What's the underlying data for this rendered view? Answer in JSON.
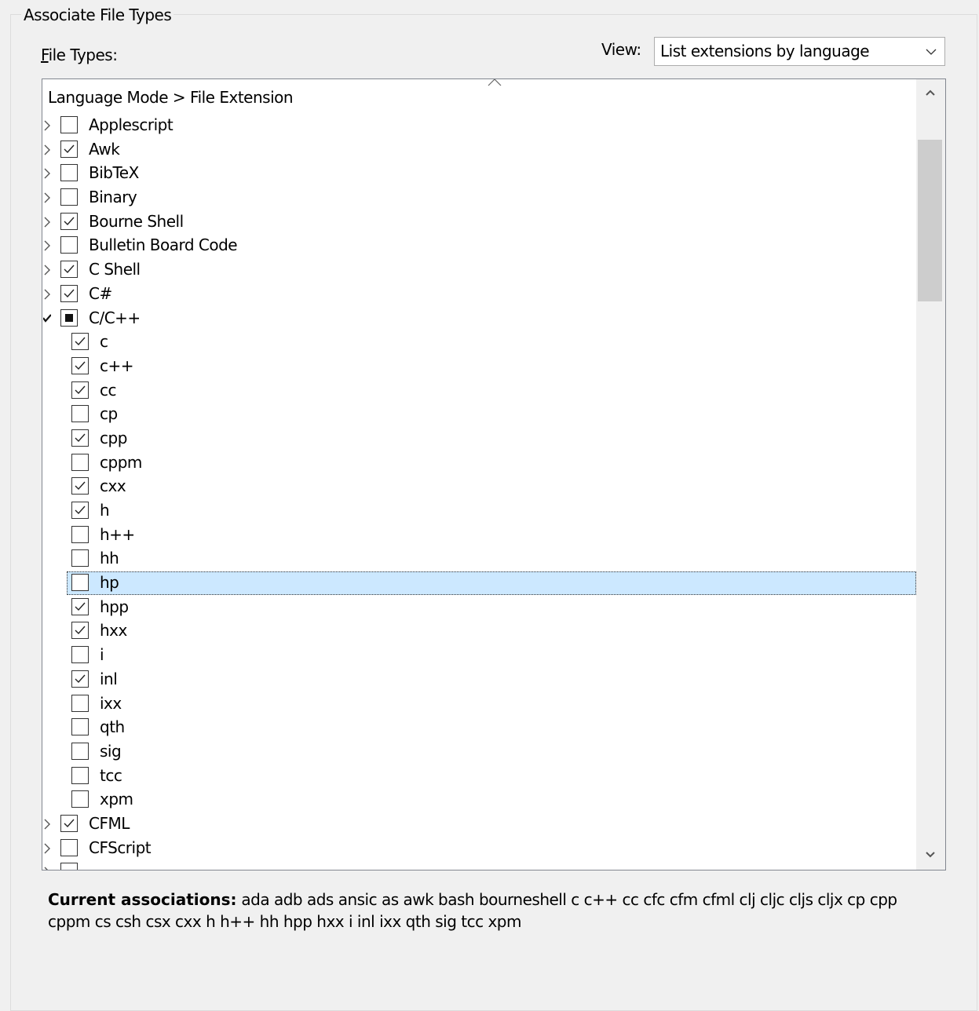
{
  "group": {
    "title": "Associate File Types"
  },
  "file_types": {
    "label_mnemonic": "F",
    "label_rest": "ile Types:"
  },
  "view": {
    "label": "View:",
    "selected": "List extensions by language"
  },
  "list": {
    "header": "Language Mode > File Extension",
    "rows": [
      {
        "level": 0,
        "expander": "collapsed",
        "state": "unchecked",
        "label": "Applescript"
      },
      {
        "level": 0,
        "expander": "collapsed",
        "state": "checked",
        "label": "Awk"
      },
      {
        "level": 0,
        "expander": "collapsed",
        "state": "unchecked",
        "label": "BibTeX"
      },
      {
        "level": 0,
        "expander": "collapsed",
        "state": "unchecked",
        "label": "Binary"
      },
      {
        "level": 0,
        "expander": "collapsed",
        "state": "checked",
        "label": "Bourne Shell"
      },
      {
        "level": 0,
        "expander": "collapsed",
        "state": "unchecked",
        "label": "Bulletin Board Code"
      },
      {
        "level": 0,
        "expander": "collapsed",
        "state": "checked",
        "label": "C Shell"
      },
      {
        "level": 0,
        "expander": "collapsed",
        "state": "checked",
        "label": "C#"
      },
      {
        "level": 0,
        "expander": "expanded",
        "state": "indeterminate",
        "label": "C/C++"
      },
      {
        "level": 1,
        "state": "checked",
        "label": "c"
      },
      {
        "level": 1,
        "state": "checked",
        "label": "c++"
      },
      {
        "level": 1,
        "state": "checked",
        "label": "cc"
      },
      {
        "level": 1,
        "state": "unchecked",
        "label": "cp"
      },
      {
        "level": 1,
        "state": "checked",
        "label": "cpp"
      },
      {
        "level": 1,
        "state": "unchecked",
        "label": "cppm"
      },
      {
        "level": 1,
        "state": "checked",
        "label": "cxx"
      },
      {
        "level": 1,
        "state": "checked",
        "label": "h"
      },
      {
        "level": 1,
        "state": "unchecked",
        "label": "h++"
      },
      {
        "level": 1,
        "state": "unchecked",
        "label": "hh"
      },
      {
        "level": 1,
        "state": "unchecked",
        "label": "hp",
        "selected": true
      },
      {
        "level": 1,
        "state": "checked",
        "label": "hpp"
      },
      {
        "level": 1,
        "state": "checked",
        "label": "hxx"
      },
      {
        "level": 1,
        "state": "unchecked",
        "label": "i"
      },
      {
        "level": 1,
        "state": "checked",
        "label": "inl"
      },
      {
        "level": 1,
        "state": "unchecked",
        "label": "ixx"
      },
      {
        "level": 1,
        "state": "unchecked",
        "label": "qth"
      },
      {
        "level": 1,
        "state": "unchecked",
        "label": "sig"
      },
      {
        "level": 1,
        "state": "unchecked",
        "label": "tcc"
      },
      {
        "level": 1,
        "state": "unchecked",
        "label": "xpm"
      },
      {
        "level": 0,
        "expander": "collapsed",
        "state": "checked",
        "label": "CFML"
      },
      {
        "level": 0,
        "expander": "collapsed",
        "state": "unchecked",
        "label": "CFScript"
      },
      {
        "level": 0,
        "expander": "collapsed",
        "state": "unchecked",
        "label": ""
      }
    ]
  },
  "associations": {
    "label": "Current associations:",
    "value": "ada adb ads ansic as awk bash bourneshell c c++ cc cfc cfm cfml clj cljc cljs cljx cp cpp cppm cs csh csx cxx h h++ hh hpp hxx i inl ixx qth sig tcc xpm"
  },
  "icons": {
    "dropdown": "chevron-down-icon",
    "sort": "sort-ascending-icon",
    "scroll_up": "scroll-up-icon",
    "scroll_down": "scroll-down-icon",
    "collapsed": "chevron-right-icon",
    "expanded": "chevron-down-icon"
  },
  "colors": {
    "selection": "#cce8ff",
    "background": "#f0f0f0",
    "thumb": "#cdcdcd"
  }
}
